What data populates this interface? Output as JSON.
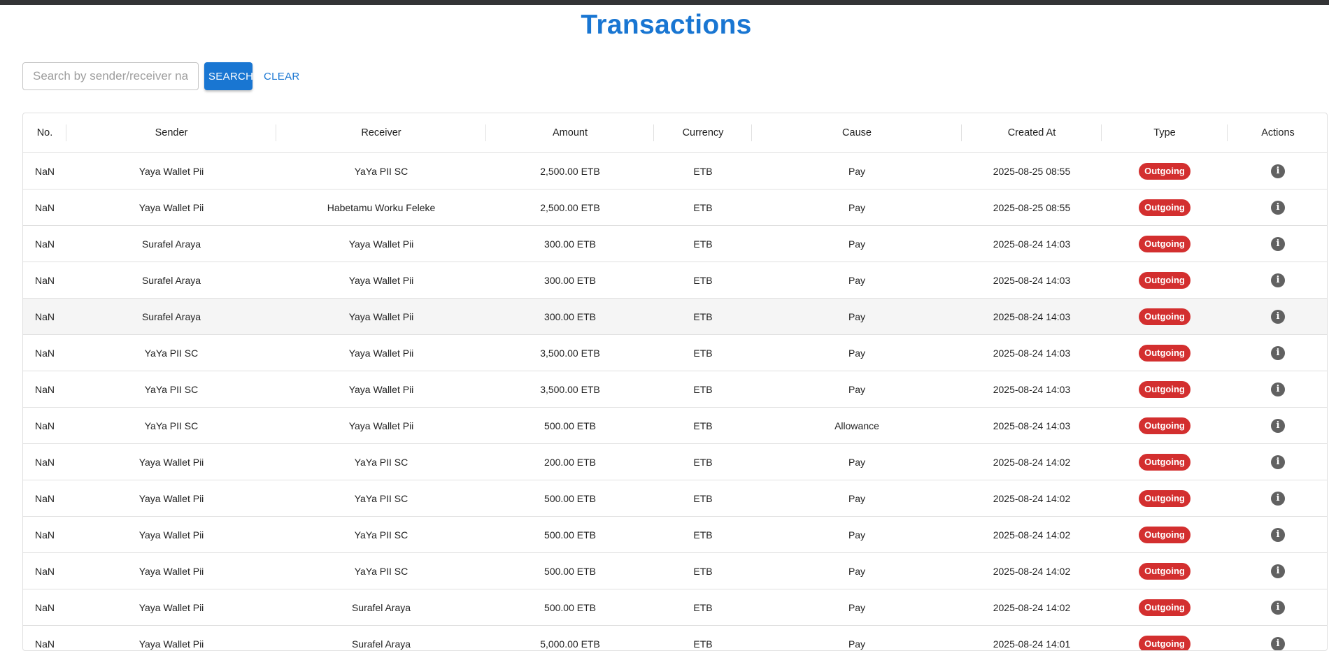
{
  "page": {
    "title": "Transactions"
  },
  "search": {
    "placeholder": "Search by sender/receiver name",
    "value": "",
    "search_label": "SEARCH",
    "clear_label": "CLEAR"
  },
  "colors": {
    "accent": "#1976d2",
    "outgoing_badge": "#d32f2f",
    "info_icon": "#616161"
  },
  "table": {
    "columns": [
      "No.",
      "Sender",
      "Receiver",
      "Amount",
      "Currency",
      "Cause",
      "Created At",
      "Type",
      "Actions"
    ],
    "action_icon": "info-icon",
    "rows": [
      {
        "no": "NaN",
        "sender": "Yaya Wallet Pii",
        "receiver": "YaYa PII SC",
        "amount": "2,500.00 ETB",
        "currency": "ETB",
        "cause": "Pay",
        "created_at": "2025-08-25 08:55",
        "type": "Outgoing"
      },
      {
        "no": "NaN",
        "sender": "Yaya Wallet Pii",
        "receiver": "Habetamu Worku Feleke",
        "amount": "2,500.00 ETB",
        "currency": "ETB",
        "cause": "Pay",
        "created_at": "2025-08-25 08:55",
        "type": "Outgoing"
      },
      {
        "no": "NaN",
        "sender": "Surafel Araya",
        "receiver": "Yaya Wallet Pii",
        "amount": "300.00 ETB",
        "currency": "ETB",
        "cause": "Pay",
        "created_at": "2025-08-24 14:03",
        "type": "Outgoing"
      },
      {
        "no": "NaN",
        "sender": "Surafel Araya",
        "receiver": "Yaya Wallet Pii",
        "amount": "300.00 ETB",
        "currency": "ETB",
        "cause": "Pay",
        "created_at": "2025-08-24 14:03",
        "type": "Outgoing"
      },
      {
        "no": "NaN",
        "sender": "Surafel Araya",
        "receiver": "Yaya Wallet Pii",
        "amount": "300.00 ETB",
        "currency": "ETB",
        "cause": "Pay",
        "created_at": "2025-08-24 14:03",
        "type": "Outgoing",
        "hovered": true
      },
      {
        "no": "NaN",
        "sender": "YaYa PII SC",
        "receiver": "Yaya Wallet Pii",
        "amount": "3,500.00 ETB",
        "currency": "ETB",
        "cause": "Pay",
        "created_at": "2025-08-24 14:03",
        "type": "Outgoing"
      },
      {
        "no": "NaN",
        "sender": "YaYa PII SC",
        "receiver": "Yaya Wallet Pii",
        "amount": "3,500.00 ETB",
        "currency": "ETB",
        "cause": "Pay",
        "created_at": "2025-08-24 14:03",
        "type": "Outgoing"
      },
      {
        "no": "NaN",
        "sender": "YaYa PII SC",
        "receiver": "Yaya Wallet Pii",
        "amount": "500.00 ETB",
        "currency": "ETB",
        "cause": "Allowance",
        "created_at": "2025-08-24 14:03",
        "type": "Outgoing"
      },
      {
        "no": "NaN",
        "sender": "Yaya Wallet Pii",
        "receiver": "YaYa PII SC",
        "amount": "200.00 ETB",
        "currency": "ETB",
        "cause": "Pay",
        "created_at": "2025-08-24 14:02",
        "type": "Outgoing"
      },
      {
        "no": "NaN",
        "sender": "Yaya Wallet Pii",
        "receiver": "YaYa PII SC",
        "amount": "500.00 ETB",
        "currency": "ETB",
        "cause": "Pay",
        "created_at": "2025-08-24 14:02",
        "type": "Outgoing"
      },
      {
        "no": "NaN",
        "sender": "Yaya Wallet Pii",
        "receiver": "YaYa PII SC",
        "amount": "500.00 ETB",
        "currency": "ETB",
        "cause": "Pay",
        "created_at": "2025-08-24 14:02",
        "type": "Outgoing"
      },
      {
        "no": "NaN",
        "sender": "Yaya Wallet Pii",
        "receiver": "YaYa PII SC",
        "amount": "500.00 ETB",
        "currency": "ETB",
        "cause": "Pay",
        "created_at": "2025-08-24 14:02",
        "type": "Outgoing"
      },
      {
        "no": "NaN",
        "sender": "Yaya Wallet Pii",
        "receiver": "Surafel Araya",
        "amount": "500.00 ETB",
        "currency": "ETB",
        "cause": "Pay",
        "created_at": "2025-08-24 14:02",
        "type": "Outgoing"
      },
      {
        "no": "NaN",
        "sender": "Yaya Wallet Pii",
        "receiver": "Surafel Araya",
        "amount": "5,000.00 ETB",
        "currency": "ETB",
        "cause": "Pay",
        "created_at": "2025-08-24 14:01",
        "type": "Outgoing"
      }
    ]
  }
}
